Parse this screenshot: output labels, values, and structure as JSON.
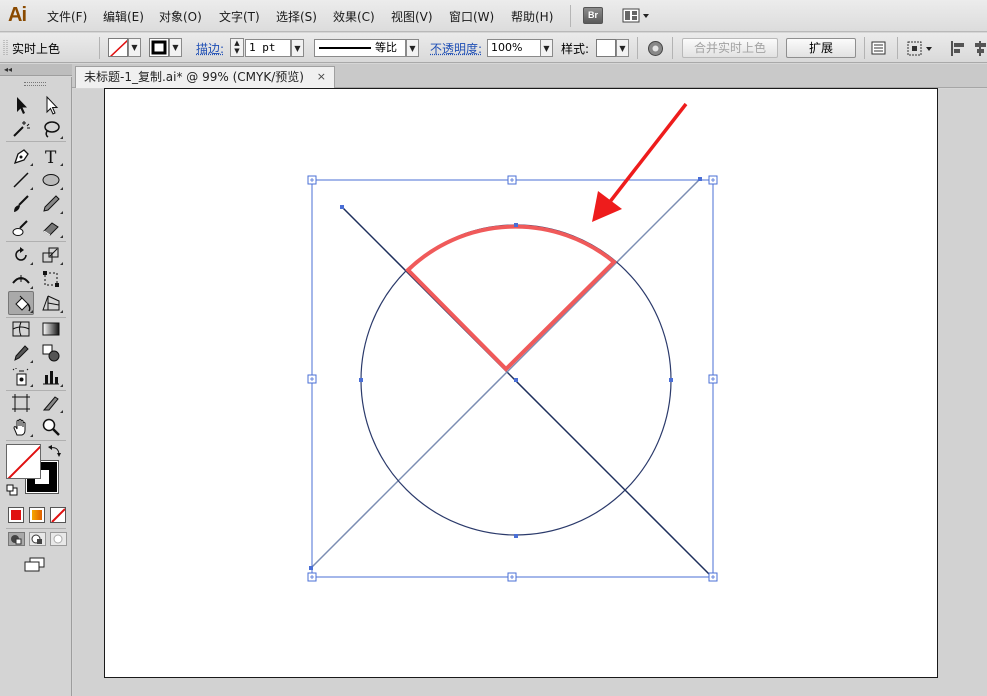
{
  "app": {
    "logo": "Ai"
  },
  "menu": {
    "items": [
      "文件(F)",
      "编辑(E)",
      "对象(O)",
      "文字(T)",
      "选择(S)",
      "效果(C)",
      "视图(V)",
      "窗口(W)",
      "帮助(H)"
    ],
    "bridge_label": "Br"
  },
  "control": {
    "mode_label": "实时上色",
    "stroke_label": "描边:",
    "stroke_weight": "1 pt",
    "profile_label": "等比",
    "opacity_label": "不透明度:",
    "opacity_value": "100%",
    "style_label": "样式:",
    "merge_button": "合并实时上色",
    "expand_button": "扩展"
  },
  "document": {
    "tab_title": "未标题-1_复制.ai* @ 99% (CMYK/预览)",
    "close_glyph": "×"
  },
  "tools": [
    "selection-tool",
    "direct-selection-tool",
    "magic-wand-tool",
    "lasso-tool",
    "pen-tool",
    "type-tool",
    "line-tool",
    "ellipse-tool",
    "paintbrush-tool",
    "pencil-tool",
    "blob-brush-tool",
    "eraser-tool",
    "rotate-tool",
    "scale-tool",
    "width-tool",
    "free-transform-tool",
    "live-paint-bucket-tool",
    "perspective-grid-tool",
    "mesh-tool",
    "gradient-tool",
    "eyedropper-tool",
    "blend-tool",
    "symbol-sprayer-tool",
    "graph-tool",
    "artboard-tool",
    "slice-tool",
    "hand-tool",
    "zoom-tool"
  ],
  "colors": {
    "highlight_stroke": "#f05a5a",
    "arrow": "#ee1c1c",
    "selection": "#4a6fd6",
    "line_dark": "#1e2f5c",
    "line_light": "#7b8db3",
    "circle_stroke": "#2b3a6b"
  }
}
